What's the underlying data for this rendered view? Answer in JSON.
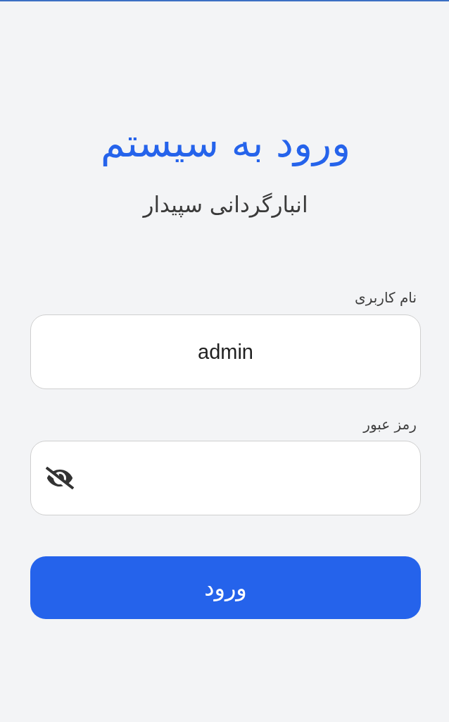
{
  "header": {
    "title": "ورود به سیستم",
    "subtitle": "انبارگردانی سپیدار"
  },
  "username": {
    "label": "نام کاربری",
    "value": "admin"
  },
  "password": {
    "label": "رمز عبور",
    "visible": false
  },
  "submit_button": {
    "label": "ورود"
  }
}
